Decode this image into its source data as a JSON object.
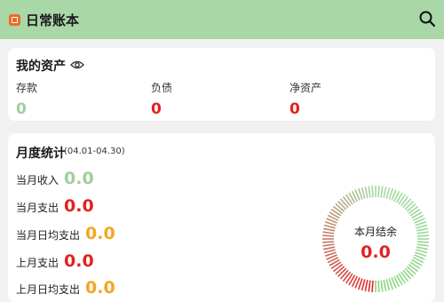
{
  "header": {
    "title": "日常账本",
    "search_icon": "search-icon",
    "background": "#a9d7a7"
  },
  "assets": {
    "title": "我的资产",
    "visibility_icon": "eye-icon",
    "items": [
      {
        "label": "存款",
        "value": "0",
        "color": "#9fcf9c"
      },
      {
        "label": "负债",
        "value": "0",
        "color": "#e12222"
      },
      {
        "label": "净资产",
        "value": "0",
        "color": "#e12222"
      }
    ]
  },
  "stats": {
    "title": "月度统计",
    "range": "(04.01-04.30)",
    "rows": [
      {
        "label": "当月收入",
        "value": "0.0",
        "color": "#9fcf9c"
      },
      {
        "label": "当月支出",
        "value": "0.0",
        "color": "#e12222"
      },
      {
        "label": "当月日均支出",
        "value": "0.0",
        "color": "#f5a623"
      },
      {
        "label": "上月支出",
        "value": "0.0",
        "color": "#e12222"
      },
      {
        "label": "上月日均支出",
        "value": "0.0",
        "color": "#f5a623"
      }
    ],
    "gauge": {
      "label": "本月结余",
      "value": "0.0",
      "value_color": "#e12222",
      "colors": [
        "#e12222",
        "#a9d7a7",
        "#8ad67f"
      ]
    }
  }
}
